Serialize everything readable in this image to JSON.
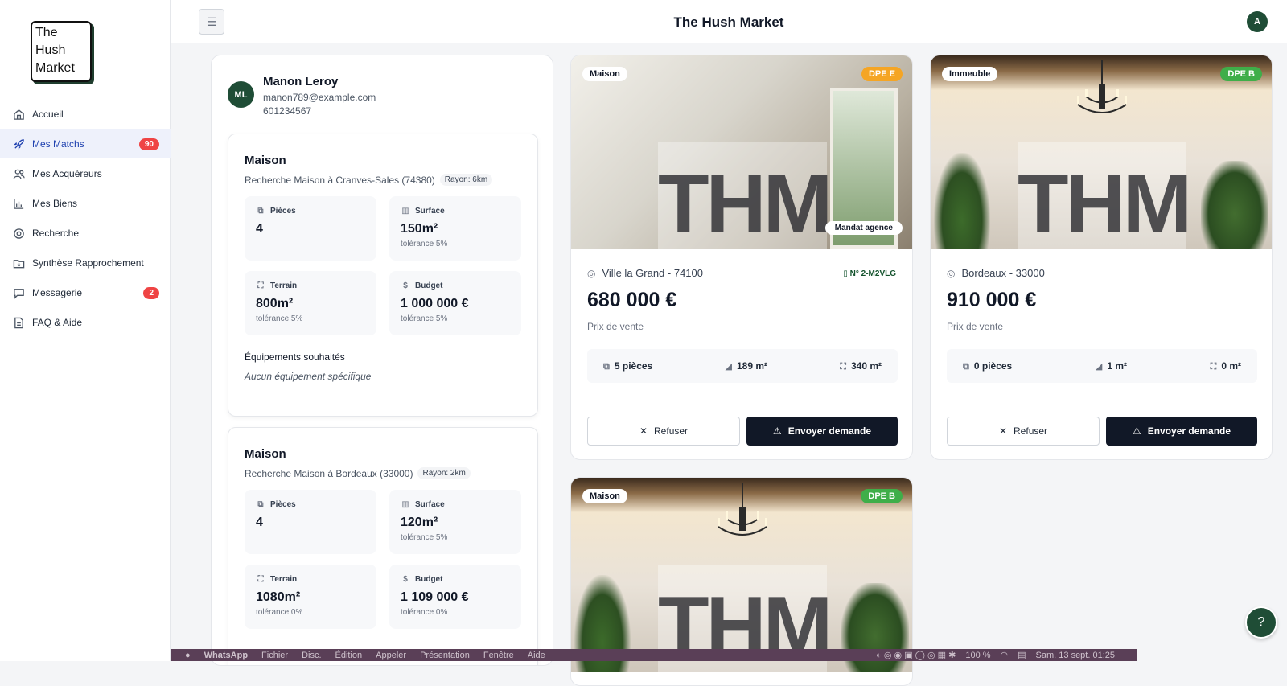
{
  "brand": {
    "logo_text": "The Hush Market",
    "accent": "#1f4d36",
    "nav_active_color": "#1e40af"
  },
  "sidebar": {
    "items": [
      {
        "label": "Accueil",
        "icon": "home-icon",
        "badge": null,
        "active": false
      },
      {
        "label": "Mes Matchs",
        "icon": "rocket-icon",
        "badge": "90",
        "active": true
      },
      {
        "label": "Mes Acquéreurs",
        "icon": "users-icon",
        "badge": null,
        "active": false
      },
      {
        "label": "Mes Biens",
        "icon": "building-chart-icon",
        "badge": null,
        "active": false
      },
      {
        "label": "Recherche",
        "icon": "search-icon",
        "badge": null,
        "active": false
      },
      {
        "label": "Synthèse Rapprochement",
        "icon": "folder-download-icon",
        "badge": null,
        "active": false
      },
      {
        "label": "Messagerie",
        "icon": "chat-icon",
        "badge": "2",
        "active": false
      },
      {
        "label": "FAQ & Aide",
        "icon": "document-icon",
        "badge": null,
        "active": false
      }
    ]
  },
  "header": {
    "title": "The Hush Market",
    "user_initial": "A",
    "menu_icon": "hamburger-icon"
  },
  "buyer": {
    "initials": "ML",
    "name": "Manon Leroy",
    "email": "manon789@example.com",
    "phone": "601234567",
    "criteria": [
      {
        "title": "Maison",
        "search": "Recherche Maison à Cranves-Sales (74380)",
        "rayon": "Rayon: 6km",
        "pieces_label": "Pièces",
        "pieces": "4",
        "surface_label": "Surface",
        "surface": "150m²",
        "surface_tol": "tolérance 5%",
        "terrain_label": "Terrain",
        "terrain": "800m²",
        "terrain_tol": "tolérance 5%",
        "budget_label": "Budget",
        "budget": "1 000 000 €",
        "budget_tol": "tolérance 5%",
        "equip_title": "Équipements souhaités",
        "equip_none": "Aucun équipement spécifique"
      },
      {
        "title": "Maison",
        "search": "Recherche Maison à Bordeaux (33000)",
        "rayon": "Rayon: 2km",
        "pieces_label": "Pièces",
        "pieces": "4",
        "surface_label": "Surface",
        "surface": "120m²",
        "surface_tol": "tolérance 5%",
        "terrain_label": "Terrain",
        "terrain": "1080m²",
        "terrain_tol": "tolérance 0%",
        "budget_label": "Budget",
        "budget": "1 109 000 €",
        "budget_tol": "tolérance 0%"
      }
    ]
  },
  "properties": [
    {
      "type": "Maison",
      "dpe": "DPE E",
      "dpe_color": "#f5a524",
      "mandat": "Mandat agence",
      "location": "Ville la Grand - 74100",
      "ref": "N° 2-M2VLG",
      "price": "680 000 €",
      "price_label": "Prix de vente",
      "pieces": "5 pièces",
      "surface": "189 m²",
      "terrain": "340 m²",
      "refuse": "Refuser",
      "send": "Envoyer demande",
      "watermark": "THM"
    },
    {
      "type": "Immeuble",
      "dpe": "DPE B",
      "dpe_color": "#3fae49",
      "location": "Bordeaux - 33000",
      "price": "910 000 €",
      "price_label": "Prix de vente",
      "pieces": "0 pièces",
      "surface": "1 m²",
      "terrain": "0 m²",
      "refuse": "Refuser",
      "send": "Envoyer demande",
      "watermark": "THM"
    },
    {
      "type": "Maison",
      "dpe": "DPE B",
      "dpe_color": "#3fae49",
      "watermark": "THM"
    }
  ],
  "macos_menubar": {
    "items": [
      "WhatsApp",
      "Fichier",
      "Disc.",
      "Édition",
      "Appeler",
      "Présentation",
      "Fenêtre",
      "Aide"
    ],
    "battery": "100 %",
    "datetime": "Sam. 13 sept. 01:25"
  }
}
